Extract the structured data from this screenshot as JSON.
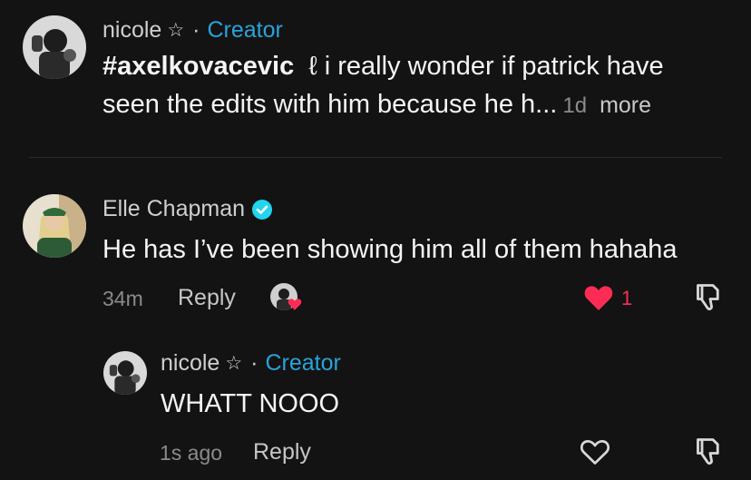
{
  "comment1": {
    "author": "nicole",
    "author_star": "☆",
    "separator": "·",
    "badge": "Creator",
    "hashtag": "#axelkovacevic",
    "inline_emoji": "ℓ",
    "text_line1": " i really wonder if patrick have",
    "text_line2": "seen the edits with him because he h...",
    "time": "1d",
    "more_label": "more"
  },
  "comment2": {
    "author": "Elle Chapman",
    "verified": true,
    "text": "He has I’ve been showing him all of them hahaha",
    "time": "34m",
    "reply_label": "Reply",
    "like_count": "1",
    "liked": true
  },
  "reply1": {
    "author": "nicole",
    "author_star": "☆",
    "separator": "·",
    "badge": "Creator",
    "text": "WHATT NOOO",
    "time": "1s ago",
    "reply_label": "Reply",
    "liked": false
  },
  "colors": {
    "background": "#131313",
    "creator_badge": "#2aa3d9",
    "like_red": "#fe2c55",
    "verified_blue": "#20d5ec"
  },
  "icons": [
    "verified-badge-icon",
    "heart-filled-icon",
    "heart-outline-icon",
    "dislike-icon",
    "creator-liked-avatar-icon"
  ]
}
